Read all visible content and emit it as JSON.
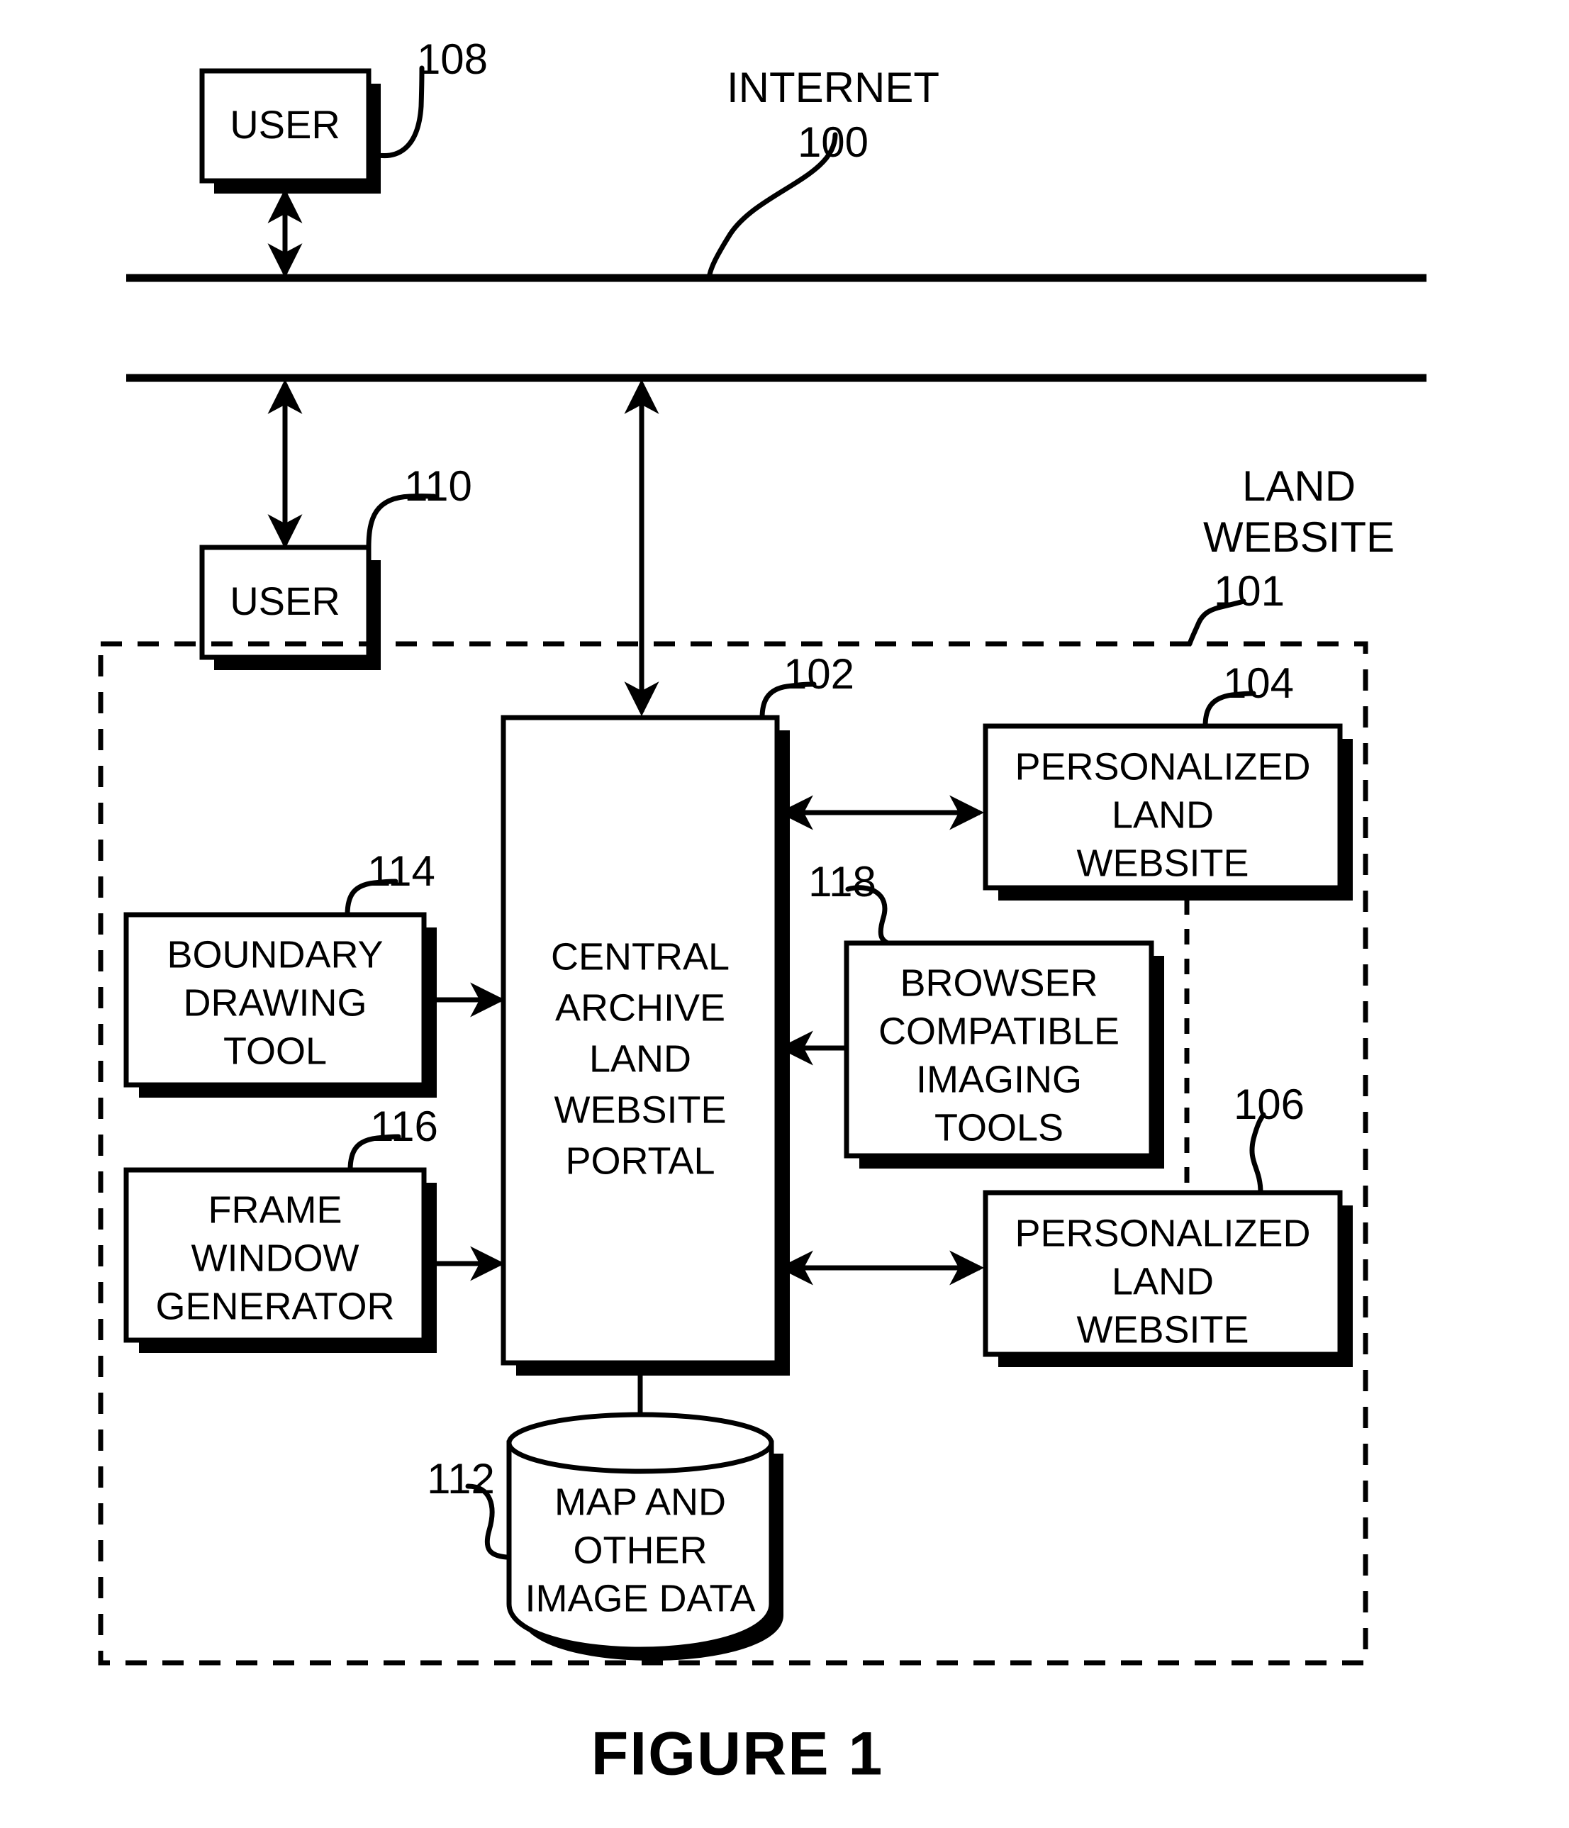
{
  "figure": {
    "caption": "FIGURE 1",
    "network_label": "INTERNET",
    "network_ref": "100",
    "system_label_line1": "LAND",
    "system_label_line2": "WEBSITE",
    "system_ref": "101"
  },
  "nodes": {
    "user_top": {
      "label": "USER",
      "ref": "108"
    },
    "user_bottom": {
      "label": "USER",
      "ref": "110"
    },
    "portal": {
      "ref": "102",
      "lines": [
        "CENTRAL",
        "ARCHIVE",
        "LAND",
        "WEBSITE",
        "PORTAL"
      ]
    },
    "personalized_site_1": {
      "ref": "104",
      "lines": [
        "PERSONALIZED",
        "LAND",
        "WEBSITE"
      ]
    },
    "personalized_site_2": {
      "ref": "106",
      "lines": [
        "PERSONALIZED",
        "LAND",
        "WEBSITE"
      ]
    },
    "boundary_tool": {
      "ref": "114",
      "lines": [
        "BOUNDARY",
        "DRAWING",
        "TOOL"
      ]
    },
    "frame_generator": {
      "ref": "116",
      "lines": [
        "FRAME",
        "WINDOW",
        "GENERATOR"
      ]
    },
    "imaging_tools": {
      "ref": "118",
      "lines": [
        "BROWSER",
        "COMPATIBLE",
        "IMAGING",
        "TOOLS"
      ]
    },
    "datastore": {
      "ref": "112",
      "lines": [
        "MAP AND",
        "OTHER",
        "IMAGE DATA"
      ]
    }
  },
  "colors": {
    "ink": "#000000",
    "paper": "#ffffff"
  }
}
